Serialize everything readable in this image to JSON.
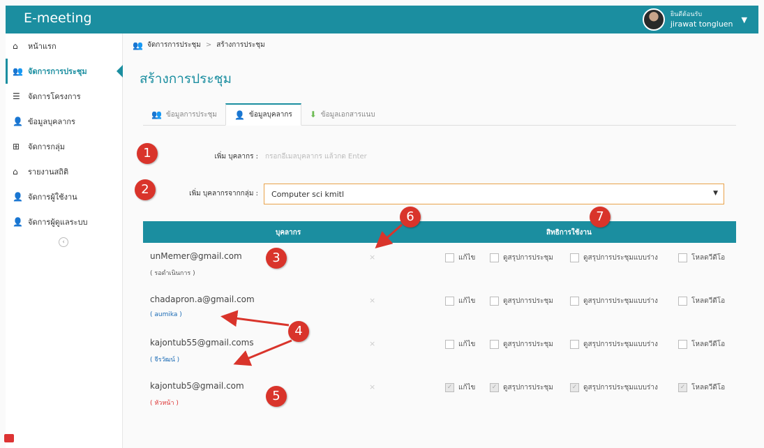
{
  "app": {
    "title": "E-meeting"
  },
  "user": {
    "welcome": "ยินดีต้อนรับ",
    "name": "jirawat tongluen"
  },
  "sidebar": {
    "items": [
      {
        "label": "หน้าแรก",
        "icon": "home-icon",
        "glyph": "⌂"
      },
      {
        "label": "จัดการการประชุม",
        "icon": "users-icon",
        "glyph": "👥"
      },
      {
        "label": "จัดการโครงการ",
        "icon": "list-icon",
        "glyph": "☰"
      },
      {
        "label": "ข้อมูลบุคลากร",
        "icon": "user-icon",
        "glyph": "👤"
      },
      {
        "label": "จัดการกลุ่ม",
        "icon": "plus-square-icon",
        "glyph": "⊞"
      },
      {
        "label": "รายงานสถิติ",
        "icon": "home-icon",
        "glyph": "⌂"
      },
      {
        "label": "จัดการผู้ใช้งาน",
        "icon": "user-icon",
        "glyph": "👤"
      },
      {
        "label": "จัดการผู้ดูแลระบบ",
        "icon": "user-icon",
        "glyph": "👤"
      }
    ],
    "collapse_glyph": "‹"
  },
  "breadcrumb": {
    "parent": "จัดการการประชุม",
    "separator": ">",
    "current": "สร้างการประชุม"
  },
  "page": {
    "title": "สร้างการประชุม"
  },
  "tabs": [
    {
      "label": "ข้อมูลการประชุม"
    },
    {
      "label": "ข้อมูลบุคลากร"
    },
    {
      "label": "ข้อมูลเอกสารแนบ"
    }
  ],
  "form": {
    "add_person_label": "เพิ่ม บุคลากร :",
    "add_person_placeholder": "กรอกอีเมลบุคลากร แล้วกด Enter",
    "add_group_label": "เพิ่ม บุคลากรจากกลุ่ม :",
    "group_selected": "Computer sci kmitl"
  },
  "table": {
    "header_person": "บุคลากร",
    "header_permission": "สิทธิการใช้งาน",
    "remove_glyph": "×",
    "perm_labels": [
      "แก้ไข",
      "ดูสรุปการประชุม",
      "ดูสรุปการประชุมแบบร่าง",
      "โหลดวีดีโอ"
    ],
    "rows": [
      {
        "email": "unMemer@gmail.com",
        "status": "( รอดำเนินการ )",
        "status_color": "#555555",
        "checked": [
          false,
          false,
          false,
          false
        ]
      },
      {
        "email": "chadapron.a@gmail.com",
        "status": "( aumika )",
        "status_color": "#1b6bb5",
        "checked": [
          false,
          false,
          false,
          false
        ]
      },
      {
        "email": "kajontub55@gmail.coms",
        "status": "( จีรวัฒน์ )",
        "status_color": "#1b6bb5",
        "checked": [
          false,
          false,
          false,
          false
        ]
      },
      {
        "email": "kajontub5@gmail.com",
        "status": "( หัวหน้า )",
        "status_color": "#d33333",
        "checked": [
          true,
          true,
          true,
          true
        ]
      }
    ]
  },
  "callouts": [
    "1",
    "2",
    "3",
    "4",
    "5",
    "6",
    "7"
  ],
  "colors": {
    "accent": "#1b8ea0",
    "callout": "#d9342b",
    "select_border": "#e9a24a"
  }
}
